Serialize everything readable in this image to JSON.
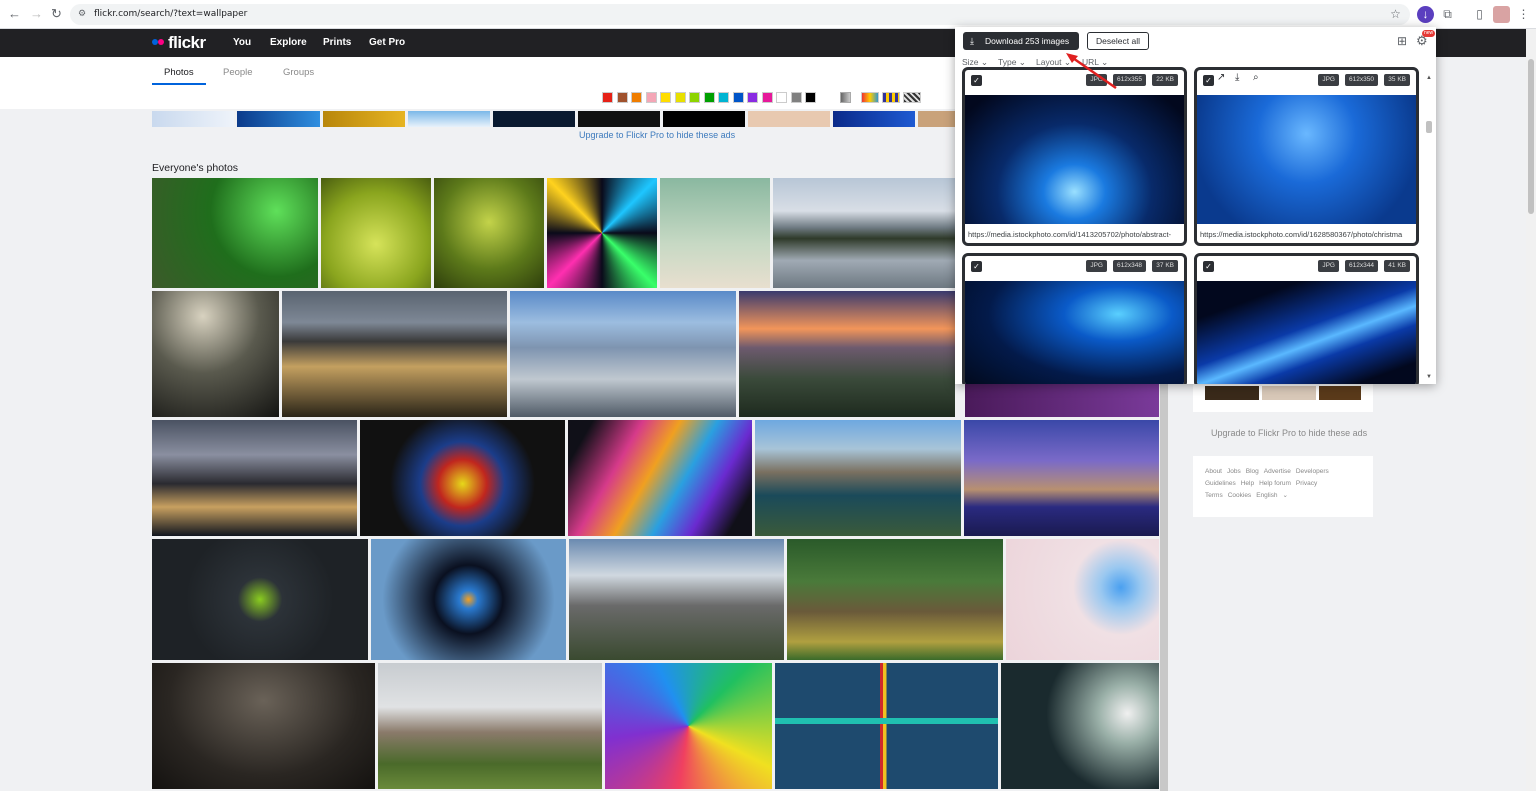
{
  "browser": {
    "url": "flickr.com/search/?text=wallpaper"
  },
  "flickr": {
    "logo": "flickr",
    "nav": [
      "You",
      "Explore",
      "Prints",
      "Get Pro"
    ],
    "tabs": [
      "Photos",
      "People",
      "Groups"
    ],
    "active_tab": "Photos",
    "upgrade_text": "Upgrade to Flickr Pro to hide these ads",
    "section_title": "Everyone's photos",
    "swatch_colors": [
      "#e62117",
      "#a0522d",
      "#ef7d00",
      "#f4a6b6",
      "#ffdd00",
      "#e8e000",
      "#8dd400",
      "#00a000",
      "#00b4d2",
      "#0055c8",
      "#8a2be2",
      "#e6199a",
      "#ffffff",
      "#808080",
      "#000000"
    ],
    "footer_links": [
      "About",
      "Jobs",
      "Blog",
      "Advertise",
      "Developers",
      "Guidelines",
      "Help",
      "Help forum",
      "Privacy",
      "Terms",
      "Cookies",
      "English"
    ]
  },
  "downloader": {
    "download_label": "Download 253 images",
    "deselect_label": "Deselect all",
    "filters": [
      "Size",
      "Type",
      "Layout",
      "URL"
    ],
    "new_badge": "new",
    "cards": [
      {
        "format": "JPG",
        "dims": "612x355",
        "size": "22 KB",
        "url": "https://media.istockphoto.com/id/1413205702/photo/abstract-"
      },
      {
        "format": "JPG",
        "dims": "612x350",
        "size": "35 KB",
        "url": "https://media.istockphoto.com/id/1628580367/photo/christma"
      },
      {
        "format": "JPG",
        "dims": "612x348",
        "size": "37 KB",
        "url": ""
      },
      {
        "format": "JPG",
        "dims": "612x344",
        "size": "41 KB",
        "url": ""
      }
    ]
  }
}
